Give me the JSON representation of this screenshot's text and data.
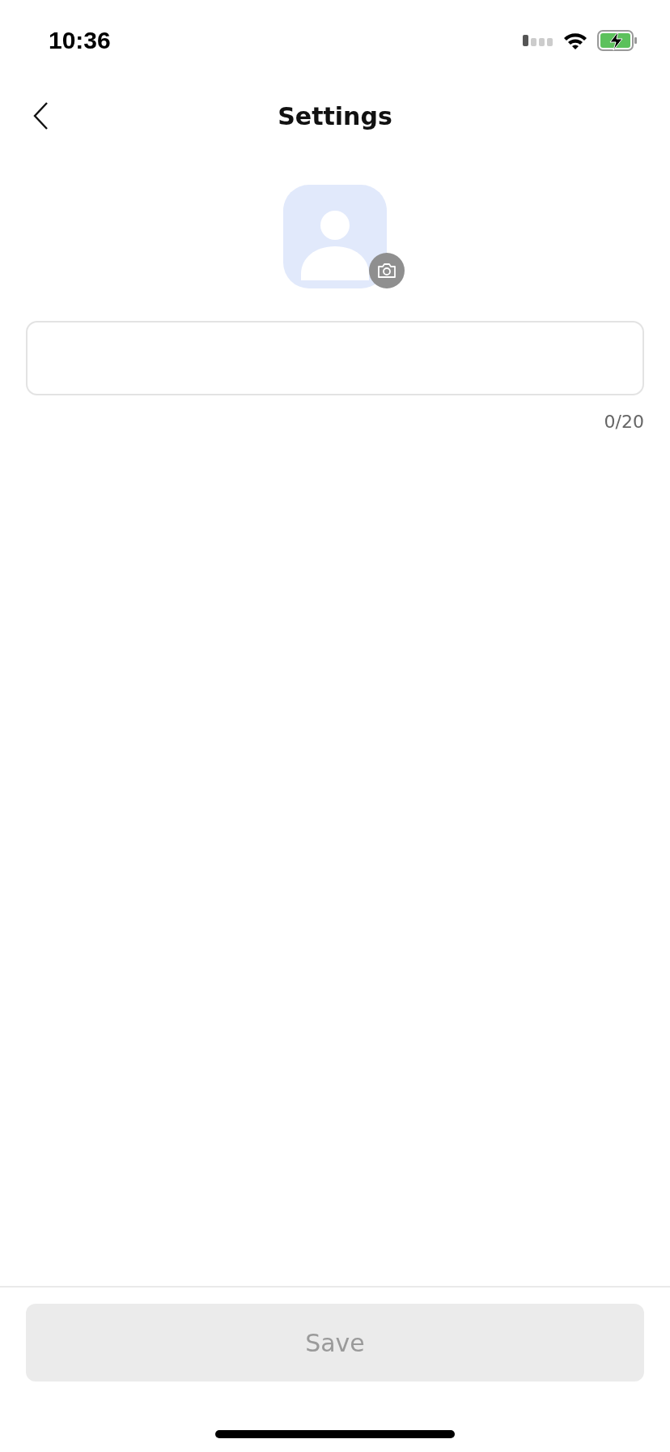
{
  "status_bar": {
    "time": "10:36"
  },
  "nav": {
    "title": "Settings"
  },
  "name_field": {
    "counter": "0/20"
  },
  "save_button": {
    "label": "Save",
    "disabled": true
  }
}
